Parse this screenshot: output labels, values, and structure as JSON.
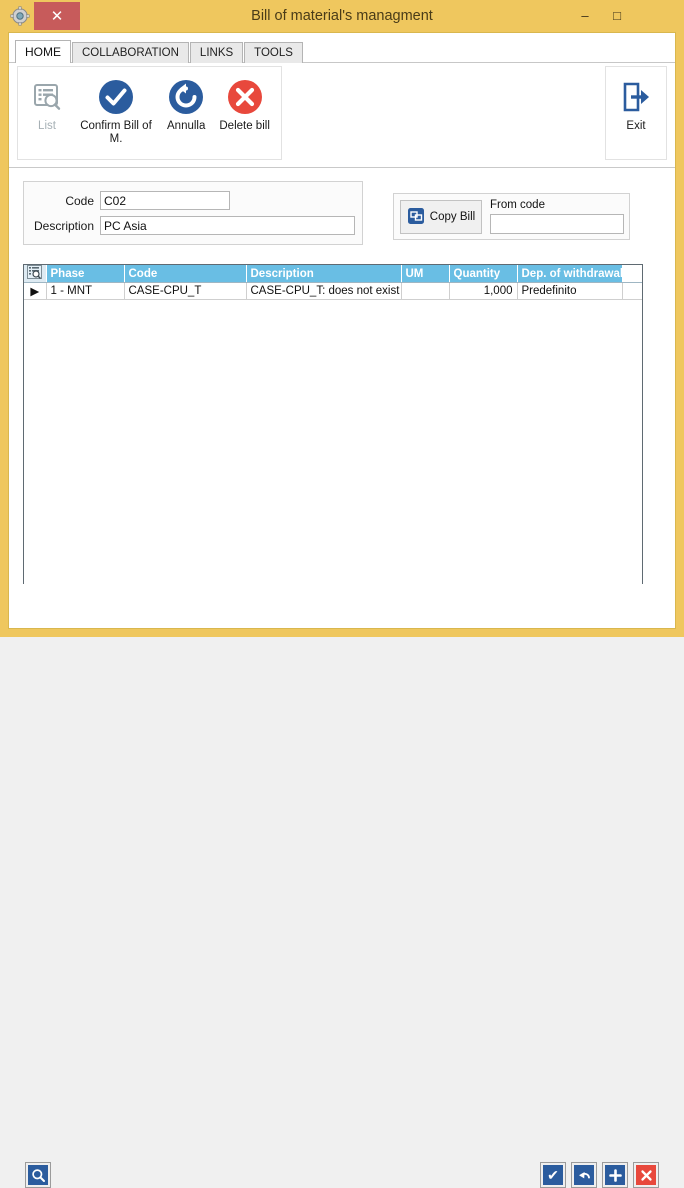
{
  "window": {
    "title": "Bill of material's managment",
    "app_icon": "gear-icon",
    "minimize_label": "–",
    "maximize_label": "□",
    "close_label": "✕",
    "accent_color": "#efc75e",
    "close_color": "#c75b5b"
  },
  "ribbon": {
    "tabs": [
      {
        "label": "HOME",
        "active": true
      },
      {
        "label": "COLLABORATION",
        "active": false
      },
      {
        "label": "LINKS",
        "active": false
      },
      {
        "label": "TOOLS",
        "active": false
      }
    ],
    "buttons": [
      {
        "label": "List",
        "icon": "list-search-icon",
        "enabled": false,
        "color": "#9aa6ac"
      },
      {
        "label": "Confirm Bill of M.",
        "icon": "check-circle-icon",
        "enabled": true,
        "color": "#2b5c9e"
      },
      {
        "label": "Annulla",
        "icon": "undo-circle-icon",
        "enabled": true,
        "color": "#2b5c9e"
      },
      {
        "label": "Delete bill",
        "icon": "x-circle-icon",
        "enabled": true,
        "color": "#e8483c"
      }
    ],
    "exit": {
      "label": "Exit",
      "icon": "exit-arrow-icon",
      "color": "#2b5c9e"
    }
  },
  "form": {
    "code_label": "Code",
    "code_value": "C02",
    "description_label": "Description",
    "description_value": "PC Asia"
  },
  "copy_panel": {
    "copy_button_label": "Copy Bill",
    "copy_button_icon": "copy-window-icon",
    "from_code_label": "From code",
    "from_code_value": ""
  },
  "grid": {
    "columns": [
      "Phase",
      "Code",
      "Description",
      "UM",
      "Quantity",
      "Dep. of withdrawal"
    ],
    "rows": [
      {
        "selected": true,
        "marker": "▶",
        "Phase": "1 - MNT",
        "Code": "CASE-CPU_T",
        "Description": "CASE-CPU_T: does not exist",
        "UM": "",
        "Quantity": "1,000",
        "Dep. of withdrawal": "Predefinito"
      }
    ],
    "header_color": "#69bee4"
  },
  "bottom_bar": {
    "search_button": {
      "icon": "magnifier-icon",
      "label": "",
      "color": "#2b5c9e"
    },
    "actions": [
      {
        "icon": "check-icon",
        "label": "✔",
        "color": "#2b5c9e"
      },
      {
        "icon": "undo-arrow-icon",
        "label": "↩",
        "color": "#2b5c9e"
      },
      {
        "icon": "plus-icon",
        "label": "＋",
        "color": "#2b5c9e"
      },
      {
        "icon": "close-x-icon",
        "label": "✕",
        "color": "#e8483c"
      }
    ]
  }
}
